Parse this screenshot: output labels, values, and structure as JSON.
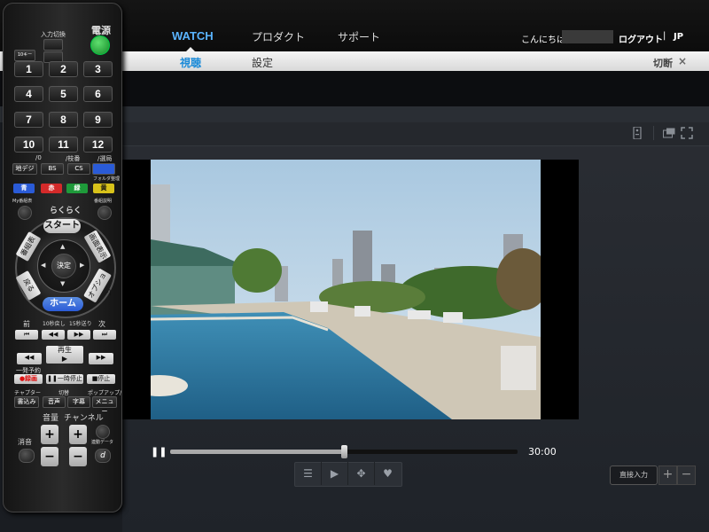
{
  "nav": {
    "items": [
      {
        "label": "WATCH",
        "active": true
      },
      {
        "label": "プロダクト",
        "active": false
      },
      {
        "label": "サポート",
        "active": false
      }
    ],
    "greeting": "こんにちは，",
    "logout": "ログアウト",
    "separator": "|",
    "lang": "JP"
  },
  "subnav": {
    "tabs": [
      {
        "label": "視聴",
        "active": true
      },
      {
        "label": "設定",
        "active": false
      }
    ],
    "disconnect": "切断",
    "disconnect_x": "×"
  },
  "player": {
    "pause_icon": "❚❚",
    "duration": "30:00",
    "progress": 0.5,
    "controls": [
      {
        "icon": "list-icon",
        "glyph": "☰"
      },
      {
        "icon": "play-icon",
        "glyph": "▶"
      },
      {
        "icon": "move-icon",
        "glyph": "✥"
      },
      {
        "icon": "heart-icon",
        "glyph": "♥"
      }
    ],
    "remote_input": "直接入力",
    "zoom_plus": "+",
    "zoom_minus": "−"
  },
  "remote": {
    "power": "電源",
    "input_switch": "入力切換",
    "ten_key": "10キー",
    "digits": [
      "1",
      "2",
      "3",
      "4",
      "5",
      "6",
      "7",
      "8",
      "9",
      "10",
      "11",
      "12"
    ],
    "lbl_0": "/0",
    "lbl_branch": "/枝番",
    "lbl_decide": "/選局",
    "band": [
      "地デジ",
      "BS",
      "CS"
    ],
    "colors": [
      {
        "label": "青",
        "color": "#2a5bd7"
      },
      {
        "label": "赤",
        "color": "#d42a2a"
      },
      {
        "label": "緑",
        "color": "#1e9a3a"
      },
      {
        "label": "黄",
        "color": "#d8c21a"
      }
    ],
    "folder": "フォルダ整理",
    "my_program": "My番組表",
    "program_desc": "番組説明",
    "rakuraku": "らくらく",
    "start": "スタート",
    "epg": "番組表",
    "screen": "画面表示",
    "back": "戻る",
    "option": "オプション",
    "home": "ホーム",
    "enter": "決定",
    "prev": "前",
    "back10": "10秒戻し",
    "fwd15": "15秒送り",
    "next": "次",
    "play": "再生",
    "oneshot": "一発予約",
    "record": "●録画",
    "pausebtn": "❚❚一時停止",
    "stop": "■停止",
    "chapter": "チャプター",
    "toggle": "切替",
    "popup": "ポップアップ/",
    "write": "書込み",
    "audio": "音声",
    "subtitle": "字幕",
    "menu": "メニュー",
    "volume": "音量",
    "channel": "チャンネル",
    "mute": "消音",
    "datalink": "連動データ",
    "plus": "+",
    "minus": "−"
  }
}
